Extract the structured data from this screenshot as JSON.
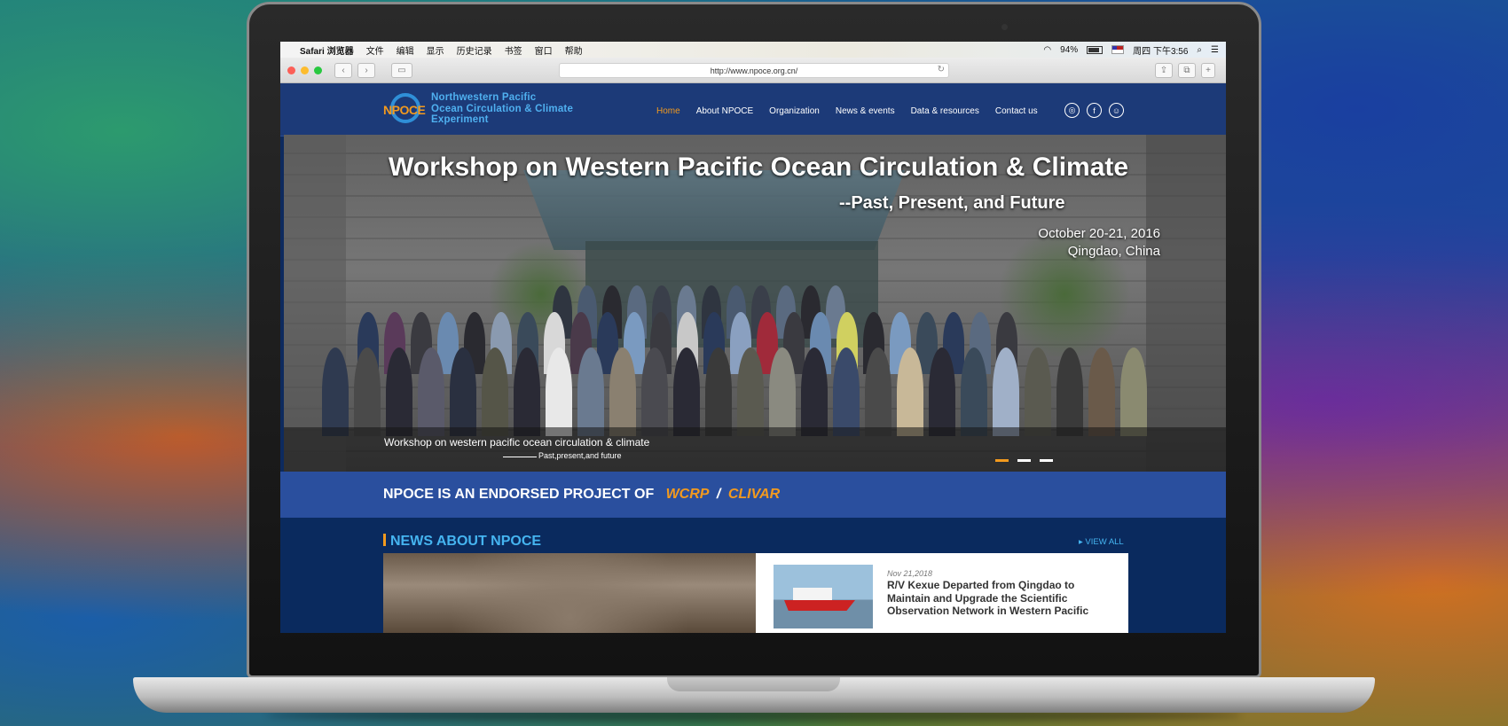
{
  "menubar": {
    "apple": "",
    "app_name": "Safari 浏览器",
    "items": [
      "文件",
      "编辑",
      "显示",
      "历史记录",
      "书签",
      "窗口",
      "帮助"
    ],
    "battery": "94%",
    "clock": "周四 下午3:56"
  },
  "browser": {
    "url": "http://www.npoce.org.cn/"
  },
  "site": {
    "logo_word": "NPOCE",
    "logo_lines": [
      "Northwestern Pacific",
      "Ocean Circulation & Climate",
      "Experiment"
    ],
    "nav": [
      "Home",
      "About NPOCE",
      "Organization",
      "News & events",
      "Data & resources",
      "Contact us"
    ],
    "active_nav": "Home"
  },
  "hero": {
    "title": "Workshop on Western Pacific Ocean Circulation & Climate",
    "subtitle": "--Past, Present, and Future",
    "date": "October 20-21, 2016",
    "location": "Qingdao, China",
    "caption": "Workshop on western pacific ocean circulation & climate",
    "caption_sub": "Past,present,and future",
    "slide_count": 3,
    "active_slide": 1
  },
  "endorse": {
    "text": "NPOCE IS AN ENDORSED PROJECT OF",
    "org1": "WCRP",
    "separator": "/",
    "org2": "CLIVAR"
  },
  "news": {
    "title": "NEWS ABOUT NPOCE",
    "view_all": "VIEW ALL",
    "item_date": "Nov 21,2018",
    "item_headline": "R/V Kexue Departed from Qingdao to Maintain and Upgrade the Scientific Observation Network in Western Pacific"
  },
  "colors": {
    "accent_orange": "#f39a1e",
    "header_blue": "#1c3a78",
    "band_blue": "#2a4f9e",
    "news_bg": "#0a2a5e",
    "link_blue": "#45b4f0"
  }
}
